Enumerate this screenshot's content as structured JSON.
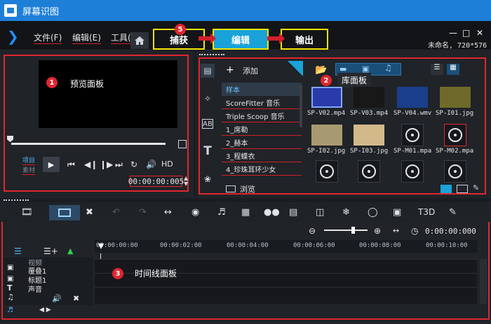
{
  "window": {
    "title": "屏幕识图"
  },
  "menu": {
    "file": "文件(F)",
    "edit": "编辑(E)",
    "tools": "工具("
  },
  "steps": {
    "capture": "捕获",
    "edit": "编辑",
    "share": "输出",
    "badge": "5"
  },
  "project": {
    "info": "未命名, 720*576"
  },
  "preview": {
    "badge": "1",
    "label": "预览面板",
    "mode_project": "项目",
    "mode_clip": "素材",
    "hd": "HD",
    "timecode": "00:00:00:005"
  },
  "library": {
    "badge": "2",
    "label": "库面板",
    "add": "添加",
    "browse": "浏览",
    "items": [
      "样本",
      "ScoreFitter 音乐",
      "Triple Scoop 音乐",
      "1_席勒",
      "2_赫本",
      "3_程蝶衣",
      "4_珍珠耳环少女"
    ],
    "thumbs": [
      "SP-V02.mp4",
      "SP-V03.mp4",
      "SP-V04.wmv",
      "SP-I01.jpg",
      "SP-I02.jpg",
      "SP-I03.jpg",
      "SP-M01.mpa",
      "SP-M02.mpa"
    ]
  },
  "timeline": {
    "badge": "3",
    "label": "时间线面板",
    "zoom_timecode": "0:00:00:000",
    "ruler": [
      "00:00:00:00",
      "00:00:02:00",
      "00:00:04:00",
      "00:00:06:00",
      "00:00:08:00",
      "00:00:10:00"
    ],
    "tracks": [
      "视频",
      "覆叠1",
      "标题1",
      "声音"
    ]
  },
  "colors": {
    "accent": "#1aa3d9",
    "annotation_red": "#e0262f",
    "step_yellow": "#f0e400",
    "title_blue": "#1e7fd8"
  }
}
